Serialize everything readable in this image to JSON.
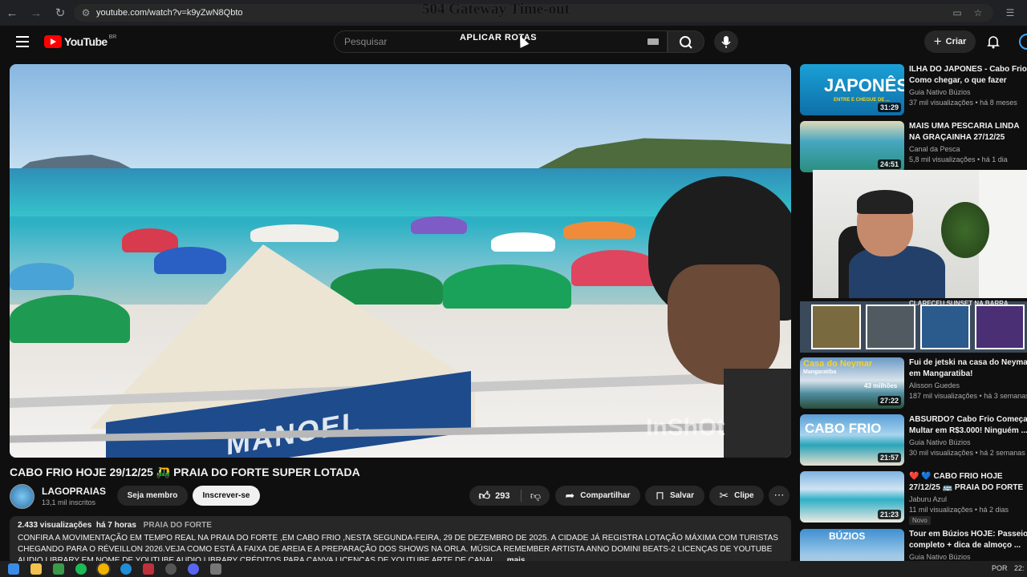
{
  "browser": {
    "url": "youtube.com/watch?v=k9yZwN8Qbto",
    "page_overlay_text": "504 Gateway Time-out"
  },
  "header": {
    "logo_text": "YouTube",
    "logo_country": "BR",
    "search_placeholder": "Pesquisar",
    "search_overlay_text": "APLICAR ROTAS",
    "create_label": "Criar"
  },
  "video": {
    "watermark": "InShOt",
    "banner_text": "MANOEL",
    "title": "CABO FRIO HOJE 29/12/25 🛺 PRAIA DO FORTE SUPER LOTADA",
    "channel_name": "LAGOPRAIAS",
    "channel_subs": "13,1 mil inscritos",
    "join_label": "Seja membro",
    "subscribe_label": "Inscrever-se",
    "like_count": "293",
    "share_label": "Compartilhar",
    "save_label": "Salvar",
    "clip_label": "Clipe"
  },
  "description": {
    "views": "2.433 visualizações",
    "age": "há 7 horas",
    "tag": "PRAIA DO FORTE",
    "text": "CONFIRA A MOVIMENTAÇÃO EM TEMPO REAL NA PRAIA DO FORTE ,EM CABO FRIO ,NESTA SEGUNDA-FEIRA, 29 DE DEZEMBRO DE 2025. A CIDADE JÁ REGISTRA LOTAÇÃO MÁXIMA COM TURISTAS CHEGANDO PARA O RÉVEILLON 2026.VEJA COMO ESTÁ A FAIXA DE AREIA E A PREPARAÇÃO DOS SHOWS NA ORLA. MÚSICA REMEMBER ARTISTA ANNO DOMINI BEATS-2 LICENÇAS DE YOUTUBE AUDIO LIBRARY EM NOME DE YOUTUBE AUDIO LIBRARY CRÉDITOS PARA CANVA LICENÇAS DE YOUTUBE ARTE DE CANAL",
    "more_label": "...mais"
  },
  "recommendations": [
    {
      "title": "ILHA DO JAPONES - Cabo Frio\nComo chegar, o que fazer",
      "channel": "Guia Nativo Búzios",
      "stats": "37 mil visualizações • há 8 meses",
      "duration": "31:29",
      "thumb_text": "JAPONÊS",
      "thumb_sub": "ENTRE E CHEGUE DE ..."
    },
    {
      "title": "MAIS UMA PESCARIA LINDA\nNA GRAÇAINHA 27/12/25",
      "channel": "Canal da Pesca",
      "stats": "5,8 mil visualizações • há 1 dia",
      "duration": "24:51"
    },
    {
      "title": "CLARECEU SUNSET NA BARRA",
      "channel": "",
      "stats": ""
    },
    {
      "title": "Fui de jetski na casa do Neymar\nem Mangaratiba!",
      "channel": "Alisson Guedes",
      "stats": "187 mil visualizações • há 3 semanas",
      "duration": "27:22",
      "thumb_text": "Casa do Neymar",
      "thumb_sub": "Mangaratiba",
      "thumb_extra": "43 milhões"
    },
    {
      "title": "ABSURDO? Cabo Frio Começa a\nMultar em R$3.000! Ninguém ...",
      "channel": "Guia Nativo Búzios",
      "stats": "30 mil visualizações • há 2 semanas",
      "duration": "21:57",
      "thumb_text": "CABO FRIO"
    },
    {
      "title": "❤️ 💙 CABO FRIO HOJE\n27/12/25 🚌 PRAIA DO FORTE",
      "channel": "Jaburu Azul",
      "stats": "11 mil visualizações • há 2 dias",
      "duration": "21:23",
      "badge": "Novo"
    },
    {
      "title": "Tour em Búzios HOJE: Passeio\ncompleto + dica de almoço ...",
      "channel": "Guia Nativo Búzios",
      "stats": "",
      "thumb_text": "BÚZIOS"
    }
  ],
  "taskbar": {
    "lang": "POR",
    "time": "22:"
  }
}
